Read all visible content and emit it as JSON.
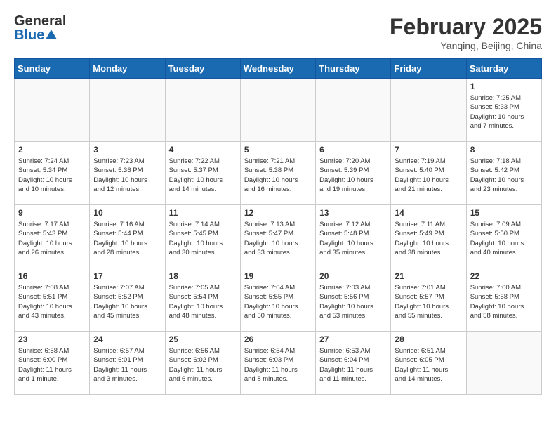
{
  "header": {
    "logo_general": "General",
    "logo_blue": "Blue",
    "month_year": "February 2025",
    "location": "Yanqing, Beijing, China"
  },
  "weekdays": [
    "Sunday",
    "Monday",
    "Tuesday",
    "Wednesday",
    "Thursday",
    "Friday",
    "Saturday"
  ],
  "weeks": [
    [
      {
        "day": "",
        "info": ""
      },
      {
        "day": "",
        "info": ""
      },
      {
        "day": "",
        "info": ""
      },
      {
        "day": "",
        "info": ""
      },
      {
        "day": "",
        "info": ""
      },
      {
        "day": "",
        "info": ""
      },
      {
        "day": "1",
        "info": "Sunrise: 7:25 AM\nSunset: 5:33 PM\nDaylight: 10 hours\nand 7 minutes."
      }
    ],
    [
      {
        "day": "2",
        "info": "Sunrise: 7:24 AM\nSunset: 5:34 PM\nDaylight: 10 hours\nand 10 minutes."
      },
      {
        "day": "3",
        "info": "Sunrise: 7:23 AM\nSunset: 5:36 PM\nDaylight: 10 hours\nand 12 minutes."
      },
      {
        "day": "4",
        "info": "Sunrise: 7:22 AM\nSunset: 5:37 PM\nDaylight: 10 hours\nand 14 minutes."
      },
      {
        "day": "5",
        "info": "Sunrise: 7:21 AM\nSunset: 5:38 PM\nDaylight: 10 hours\nand 16 minutes."
      },
      {
        "day": "6",
        "info": "Sunrise: 7:20 AM\nSunset: 5:39 PM\nDaylight: 10 hours\nand 19 minutes."
      },
      {
        "day": "7",
        "info": "Sunrise: 7:19 AM\nSunset: 5:40 PM\nDaylight: 10 hours\nand 21 minutes."
      },
      {
        "day": "8",
        "info": "Sunrise: 7:18 AM\nSunset: 5:42 PM\nDaylight: 10 hours\nand 23 minutes."
      }
    ],
    [
      {
        "day": "9",
        "info": "Sunrise: 7:17 AM\nSunset: 5:43 PM\nDaylight: 10 hours\nand 26 minutes."
      },
      {
        "day": "10",
        "info": "Sunrise: 7:16 AM\nSunset: 5:44 PM\nDaylight: 10 hours\nand 28 minutes."
      },
      {
        "day": "11",
        "info": "Sunrise: 7:14 AM\nSunset: 5:45 PM\nDaylight: 10 hours\nand 30 minutes."
      },
      {
        "day": "12",
        "info": "Sunrise: 7:13 AM\nSunset: 5:47 PM\nDaylight: 10 hours\nand 33 minutes."
      },
      {
        "day": "13",
        "info": "Sunrise: 7:12 AM\nSunset: 5:48 PM\nDaylight: 10 hours\nand 35 minutes."
      },
      {
        "day": "14",
        "info": "Sunrise: 7:11 AM\nSunset: 5:49 PM\nDaylight: 10 hours\nand 38 minutes."
      },
      {
        "day": "15",
        "info": "Sunrise: 7:09 AM\nSunset: 5:50 PM\nDaylight: 10 hours\nand 40 minutes."
      }
    ],
    [
      {
        "day": "16",
        "info": "Sunrise: 7:08 AM\nSunset: 5:51 PM\nDaylight: 10 hours\nand 43 minutes."
      },
      {
        "day": "17",
        "info": "Sunrise: 7:07 AM\nSunset: 5:52 PM\nDaylight: 10 hours\nand 45 minutes."
      },
      {
        "day": "18",
        "info": "Sunrise: 7:05 AM\nSunset: 5:54 PM\nDaylight: 10 hours\nand 48 minutes."
      },
      {
        "day": "19",
        "info": "Sunrise: 7:04 AM\nSunset: 5:55 PM\nDaylight: 10 hours\nand 50 minutes."
      },
      {
        "day": "20",
        "info": "Sunrise: 7:03 AM\nSunset: 5:56 PM\nDaylight: 10 hours\nand 53 minutes."
      },
      {
        "day": "21",
        "info": "Sunrise: 7:01 AM\nSunset: 5:57 PM\nDaylight: 10 hours\nand 55 minutes."
      },
      {
        "day": "22",
        "info": "Sunrise: 7:00 AM\nSunset: 5:58 PM\nDaylight: 10 hours\nand 58 minutes."
      }
    ],
    [
      {
        "day": "23",
        "info": "Sunrise: 6:58 AM\nSunset: 6:00 PM\nDaylight: 11 hours\nand 1 minute."
      },
      {
        "day": "24",
        "info": "Sunrise: 6:57 AM\nSunset: 6:01 PM\nDaylight: 11 hours\nand 3 minutes."
      },
      {
        "day": "25",
        "info": "Sunrise: 6:56 AM\nSunset: 6:02 PM\nDaylight: 11 hours\nand 6 minutes."
      },
      {
        "day": "26",
        "info": "Sunrise: 6:54 AM\nSunset: 6:03 PM\nDaylight: 11 hours\nand 8 minutes."
      },
      {
        "day": "27",
        "info": "Sunrise: 6:53 AM\nSunset: 6:04 PM\nDaylight: 11 hours\nand 11 minutes."
      },
      {
        "day": "28",
        "info": "Sunrise: 6:51 AM\nSunset: 6:05 PM\nDaylight: 11 hours\nand 14 minutes."
      },
      {
        "day": "",
        "info": ""
      }
    ]
  ]
}
